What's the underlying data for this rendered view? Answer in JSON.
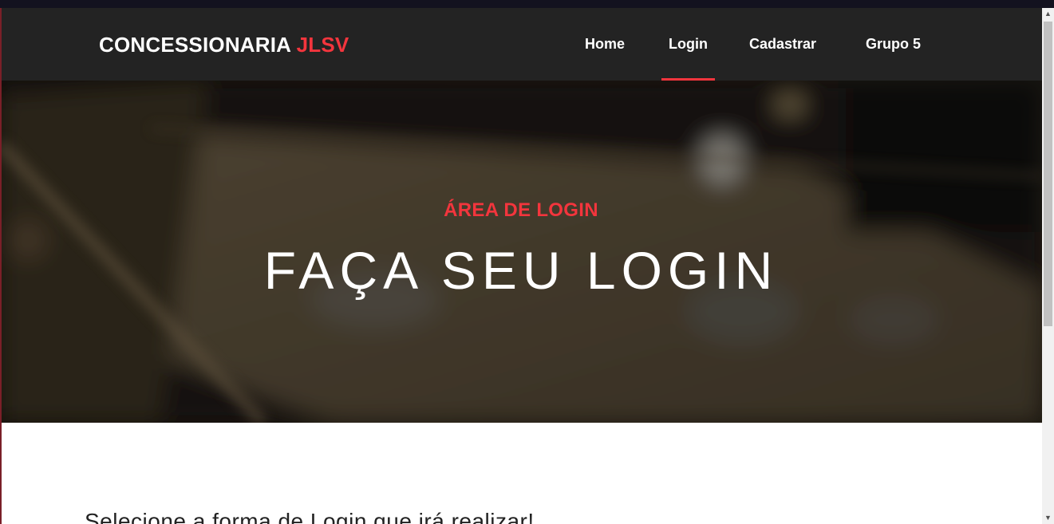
{
  "brand": {
    "name": "CONCESSIONARIA ",
    "accent": "JLSV"
  },
  "nav": {
    "items": [
      {
        "label": "Home"
      },
      {
        "label": "Login"
      },
      {
        "label": "Cadastrar"
      },
      {
        "label": "Grupo 5"
      }
    ],
    "active": "Login"
  },
  "hero": {
    "subtitle": "ÁREA DE LOGIN",
    "title": "FAÇA SEU LOGIN"
  },
  "content": {
    "text": "Selecione a forma de Login que irá realizar!"
  },
  "colors": {
    "accent": "#f3353d",
    "navbar": "#232323",
    "topstrip": "#13121f"
  },
  "icons": {
    "scroll_up": "triangle-up-icon",
    "scroll_down": "triangle-down-icon"
  }
}
